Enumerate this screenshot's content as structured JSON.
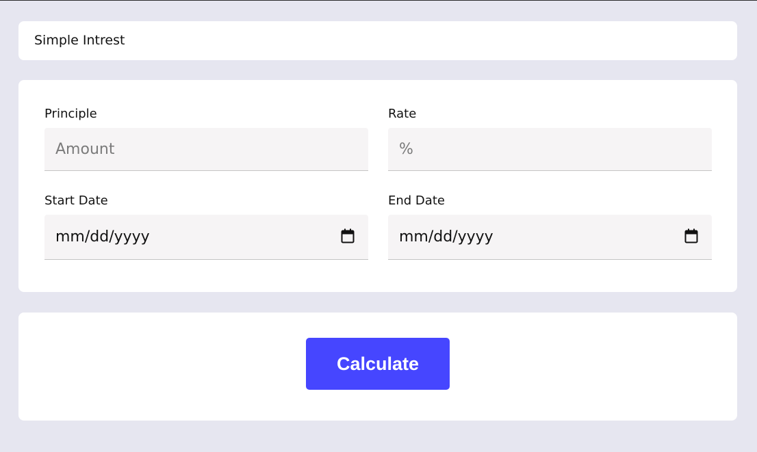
{
  "header": {
    "title": "Simple Intrest"
  },
  "form": {
    "principle": {
      "label": "Principle",
      "placeholder": "Amount",
      "value": ""
    },
    "rate": {
      "label": "Rate",
      "placeholder": "%",
      "value": ""
    },
    "start_date": {
      "label": "Start Date",
      "display": "mm/dd/yyyy",
      "icon": "calendar-icon"
    },
    "end_date": {
      "label": "End Date",
      "display": "mm/dd/yyyy",
      "icon": "calendar-icon"
    }
  },
  "actions": {
    "calculate_label": "Calculate"
  },
  "colors": {
    "page_background": "#e6e6f0",
    "card_background": "#ffffff",
    "field_background": "#f6f4f5",
    "accent": "#4646ff"
  }
}
